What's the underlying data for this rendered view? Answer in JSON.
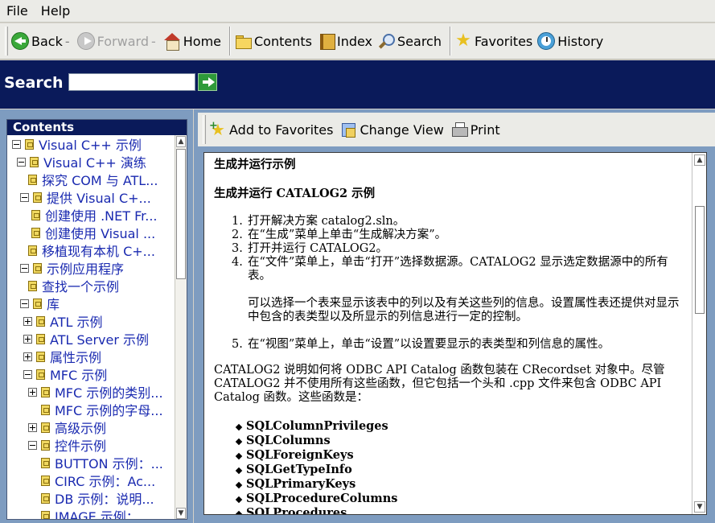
{
  "menu": {
    "items": [
      "File",
      "Help"
    ]
  },
  "toolbar": {
    "back": "Back",
    "forward": "Forward",
    "home": "Home",
    "contents": "Contents",
    "index": "Index",
    "search": "Search",
    "favorites": "Favorites",
    "history": "History"
  },
  "search_bar": {
    "label": "Search",
    "value": ""
  },
  "contents": {
    "title": "Contents",
    "items": [
      {
        "label": "Visual C++ 示例",
        "expander": "minus"
      },
      {
        "label": "Visual C++ 演练",
        "expander": "minus"
      },
      {
        "label": "探究 COM 与 ATL...",
        "expander": "none"
      },
      {
        "label": "提供 Visual C+...",
        "expander": "minus"
      },
      {
        "label": "创建使用 .NET Fr...",
        "expander": "none"
      },
      {
        "label": "创建使用 Visual ...",
        "expander": "none"
      },
      {
        "label": "移植现有本机 C+...",
        "expander": "none"
      },
      {
        "label": "示例应用程序",
        "expander": "minus"
      },
      {
        "label": "查找一个示例",
        "expander": "none"
      },
      {
        "label": "库",
        "expander": "minus"
      },
      {
        "label": "ATL 示例",
        "expander": "plus"
      },
      {
        "label": "ATL Server 示例",
        "expander": "plus"
      },
      {
        "label": "属性示例",
        "expander": "plus"
      },
      {
        "label": "MFC 示例",
        "expander": "minus"
      },
      {
        "label": "MFC 示例的类别...",
        "expander": "plus"
      },
      {
        "label": "MFC 示例的字母...",
        "expander": "none"
      },
      {
        "label": "高级示例",
        "expander": "plus"
      },
      {
        "label": "控件示例",
        "expander": "minus"
      },
      {
        "label": "BUTTON 示例：...",
        "expander": "none"
      },
      {
        "label": "CIRC 示例：Ac...",
        "expander": "none"
      },
      {
        "label": "DB 示例：说明...",
        "expander": "none"
      },
      {
        "label": "IMAGE 示例：...",
        "expander": "none"
      }
    ]
  },
  "right_toolbar": {
    "add_favorites": "Add to Favorites",
    "change_view": "Change View",
    "print": "Print"
  },
  "document": {
    "heading": "生成并运行示例",
    "subheading": "生成并运行 CATALOG2 示例",
    "steps": [
      {
        "num": "1.",
        "text": "打开解决方案 catalog2.sln。"
      },
      {
        "num": "2.",
        "text": "在“生成”菜单上单击“生成解决方案”。"
      },
      {
        "num": "3.",
        "text": "打开并运行 CATALOG2。"
      },
      {
        "num": "4.",
        "text": "在“文件”菜单上，单击“打开”选择数据源。CATALOG2 显示选定数据源中的所有表。"
      }
    ],
    "step4_note": "可以选择一个表来显示该表中的列以及有关这些列的信息。设置属性表还提供对显示中包含的表类型以及所显示的列信息进行一定的控制。",
    "step5": {
      "num": "5.",
      "text": "在“视图”菜单上，单击“设置”以设置要显示的表类型和列信息的属性。"
    },
    "paragraph": "CATALOG2 说明如何将 ODBC API Catalog 函数包装在 CRecordset 对象中。尽管 CATALOG2 并不使用所有这些函数，但它包括一个头和 .cpp 文件来包含 ODBC API Catalog 函数。这些函数是：",
    "functions": [
      "SQLColumnPrivileges",
      "SQLColumns",
      "SQLForeignKeys",
      "SQLGetTypeInfo",
      "SQLPrimaryKeys",
      "SQLProcedureColumns",
      "SQLProcedures"
    ]
  },
  "icons": {
    "back": "back-arrow-icon",
    "forward": "forward-arrow-icon",
    "home": "home-icon",
    "contents": "folder-icon",
    "index": "book-icon",
    "search": "magnifier-icon",
    "favorites": "star-icon",
    "history": "history-icon",
    "go": "go-arrow-icon",
    "tree_book": "book-icon"
  },
  "colors": {
    "search_band": "#0a1a5a",
    "frame": "#7e9cc0",
    "link": "#1a2ab0",
    "toolbar": "#ebebe7"
  }
}
